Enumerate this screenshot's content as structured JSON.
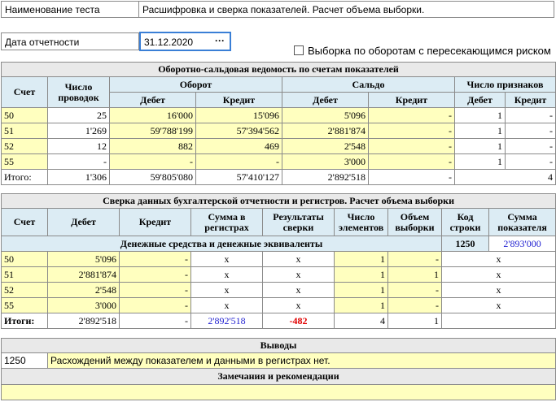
{
  "header": {
    "test_name_label": "Наименование теста",
    "test_name_value": "Расшифровка и сверка показателей. Расчет объема выборки.",
    "report_date_label": "Дата отчетности",
    "report_date_value": "31.12.2020",
    "date_button": "···",
    "checkbox_label": "Выборка по оборотам с пересекающимся риском"
  },
  "table1": {
    "title": "Оборотно-сальдовая ведомость по счетам показателей",
    "h_account": "Счет",
    "h_postings": "Число проводок",
    "h_turnover": "Оборот",
    "h_balance": "Сальдо",
    "h_signs": "Число признаков",
    "h_debit": "Дебет",
    "h_credit": "Кредит",
    "rows": [
      {
        "acc": "50",
        "cnt": "25",
        "to_d": "16'000",
        "to_c": "15'096",
        "bal_d": "5'096",
        "bal_c": "-",
        "sg_d": "1",
        "sg_c": "-"
      },
      {
        "acc": "51",
        "cnt": "1'269",
        "to_d": "59'788'199",
        "to_c": "57'394'562",
        "bal_d": "2'881'874",
        "bal_c": "-",
        "sg_d": "1",
        "sg_c": "-"
      },
      {
        "acc": "52",
        "cnt": "12",
        "to_d": "882",
        "to_c": "469",
        "bal_d": "2'548",
        "bal_c": "-",
        "sg_d": "1",
        "sg_c": "-"
      },
      {
        "acc": "55",
        "cnt": "-",
        "to_d": "-",
        "to_c": "-",
        "bal_d": "3'000",
        "bal_c": "-",
        "sg_d": "1",
        "sg_c": "-"
      }
    ],
    "total": {
      "label": "Итого:",
      "cnt": "1'306",
      "to_d": "59'805'080",
      "to_c": "57'410'127",
      "bal_d": "2'892'518",
      "bal_c": "-",
      "sg": "4"
    }
  },
  "table2": {
    "title": "Сверка данных бухгалтерской отчетности и регистров. Расчет объема выборки",
    "h_account": "Счет",
    "h_debit": "Дебет",
    "h_credit": "Кредит",
    "h_registers": "Сумма в регистрах",
    "h_results": "Результаты сверки",
    "h_elements": "Число элементов",
    "h_sample": "Объем выборки",
    "h_code": "Код строки",
    "h_indicator": "Сумма показателя",
    "group_label": "Денежные средства и денежные эквиваленты",
    "group_code": "1250",
    "group_sum": "2'893'000",
    "rows": [
      {
        "acc": "50",
        "deb": "5'096",
        "cred": "-",
        "reg": "x",
        "res": "x",
        "el": "1",
        "smp": "-",
        "ind": "x"
      },
      {
        "acc": "51",
        "deb": "2'881'874",
        "cred": "-",
        "reg": "x",
        "res": "x",
        "el": "1",
        "smp": "1",
        "ind": "x"
      },
      {
        "acc": "52",
        "deb": "2'548",
        "cred": "-",
        "reg": "x",
        "res": "x",
        "el": "1",
        "smp": "-",
        "ind": "x"
      },
      {
        "acc": "55",
        "deb": "3'000",
        "cred": "-",
        "reg": "x",
        "res": "x",
        "el": "1",
        "smp": "-",
        "ind": "x"
      }
    ],
    "total": {
      "label": "Итоги:",
      "deb": "2'892'518",
      "cred": "-",
      "reg": "2'892'518",
      "res": "-482",
      "el": "4",
      "smp": "1"
    }
  },
  "conclusions": {
    "title": "Выводы",
    "code": "1250",
    "text": "Расхождений между показателем и данными в регистрах нет.",
    "remarks_title": "Замечания и рекомендации",
    "remarks_text": ""
  }
}
